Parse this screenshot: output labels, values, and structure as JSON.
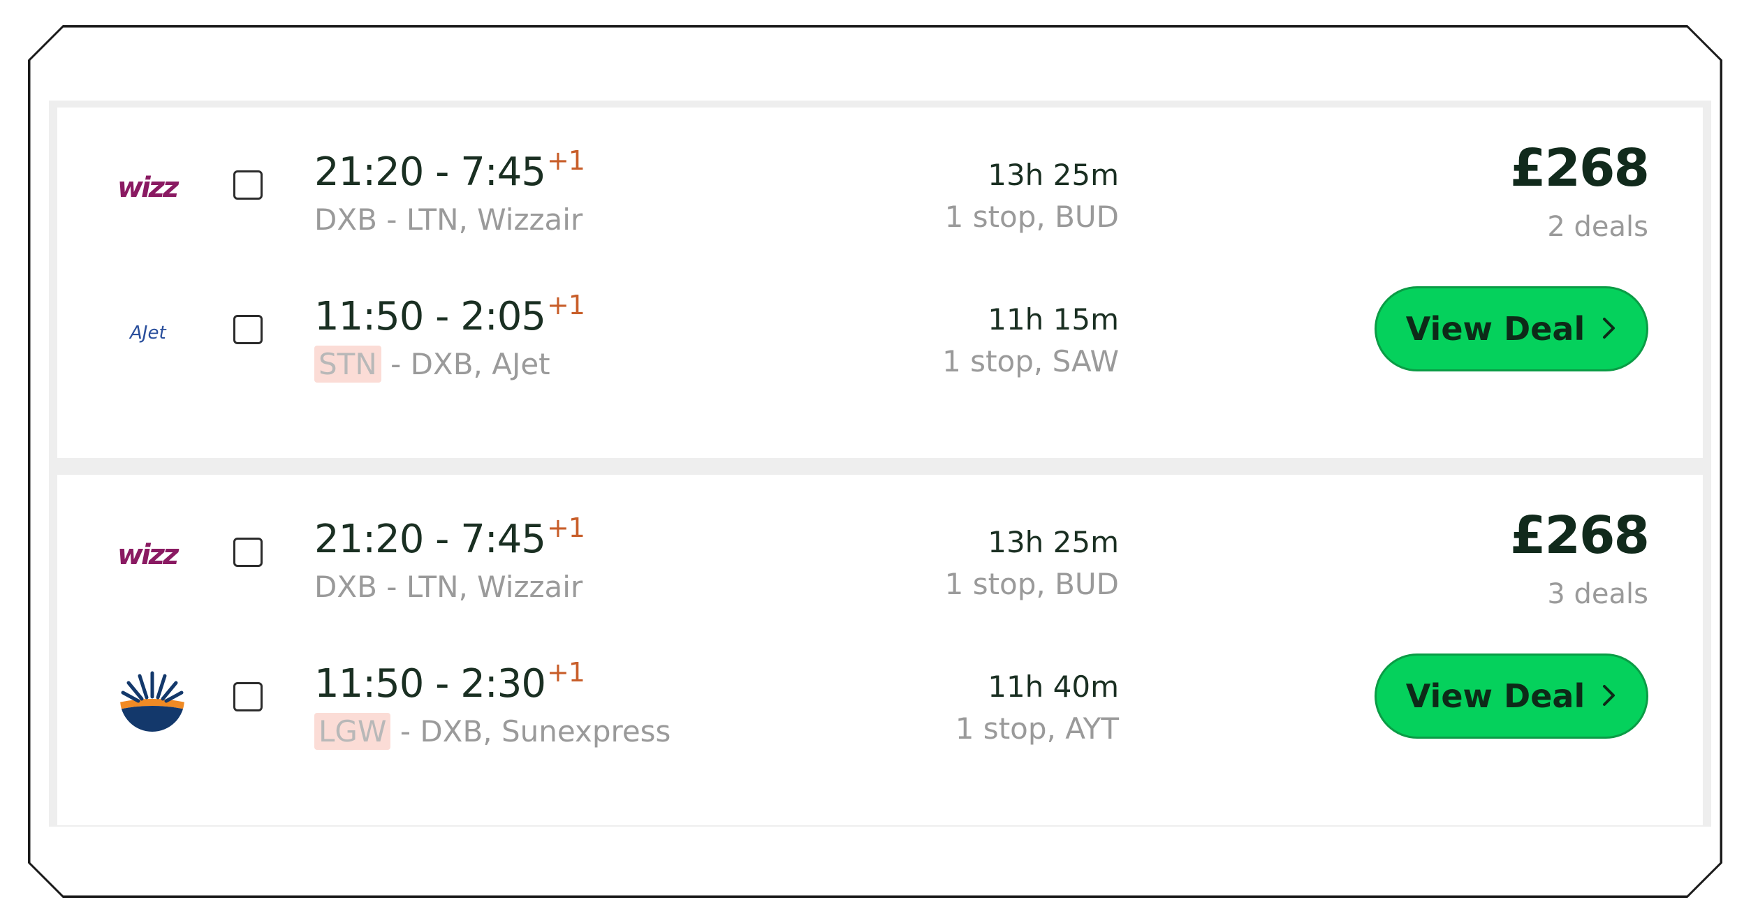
{
  "results": [
    {
      "price": "£268",
      "deals": "2 deals",
      "button_label": "View Deal",
      "legs": [
        {
          "airline": "Wizzair",
          "logo_text": "wizz",
          "times": "21:20 - 7:45",
          "day_offset": "+1",
          "origin": "DXB",
          "rest": " - LTN, Wizzair",
          "origin_highlight": false,
          "duration": "13h 25m",
          "stops": "1 stop, BUD"
        },
        {
          "airline": "AJet",
          "logo_text": "AJet",
          "times": "11:50 - 2:05",
          "day_offset": "+1",
          "origin": "STN",
          "rest": " - DXB, AJet",
          "origin_highlight": true,
          "duration": "11h 15m",
          "stops": "1 stop, SAW"
        }
      ]
    },
    {
      "price": "£268",
      "deals": "3 deals",
      "button_label": "View Deal",
      "legs": [
        {
          "airline": "Wizzair",
          "logo_text": "wizz",
          "times": "21:20 - 7:45",
          "day_offset": "+1",
          "origin": "DXB",
          "rest": " - LTN, Wizzair",
          "origin_highlight": false,
          "duration": "13h 25m",
          "stops": "1 stop, BUD"
        },
        {
          "airline": "Sunexpress",
          "logo_text": "",
          "times": "11:50 - 2:30",
          "day_offset": "+1",
          "origin": "LGW",
          "rest": " - DXB, Sunexpress",
          "origin_highlight": true,
          "duration": "11h 40m",
          "stops": "1 stop, AYT"
        }
      ]
    }
  ],
  "icons": {
    "chevron": "chevron-right-icon",
    "wizz_logo": "wizzair-logo",
    "ajet_logo": "ajet-logo",
    "sunexpress_logo": "sunexpress-logo"
  },
  "colors": {
    "button_bg": "#05d15c",
    "day_offset": "#c85e2a",
    "highlight": "#fbdcd6",
    "wizz": "#8a1a62",
    "ajet": "#2a4f9c",
    "sunexpress_blue": "#13386b",
    "sunexpress_orange": "#f08a24"
  }
}
